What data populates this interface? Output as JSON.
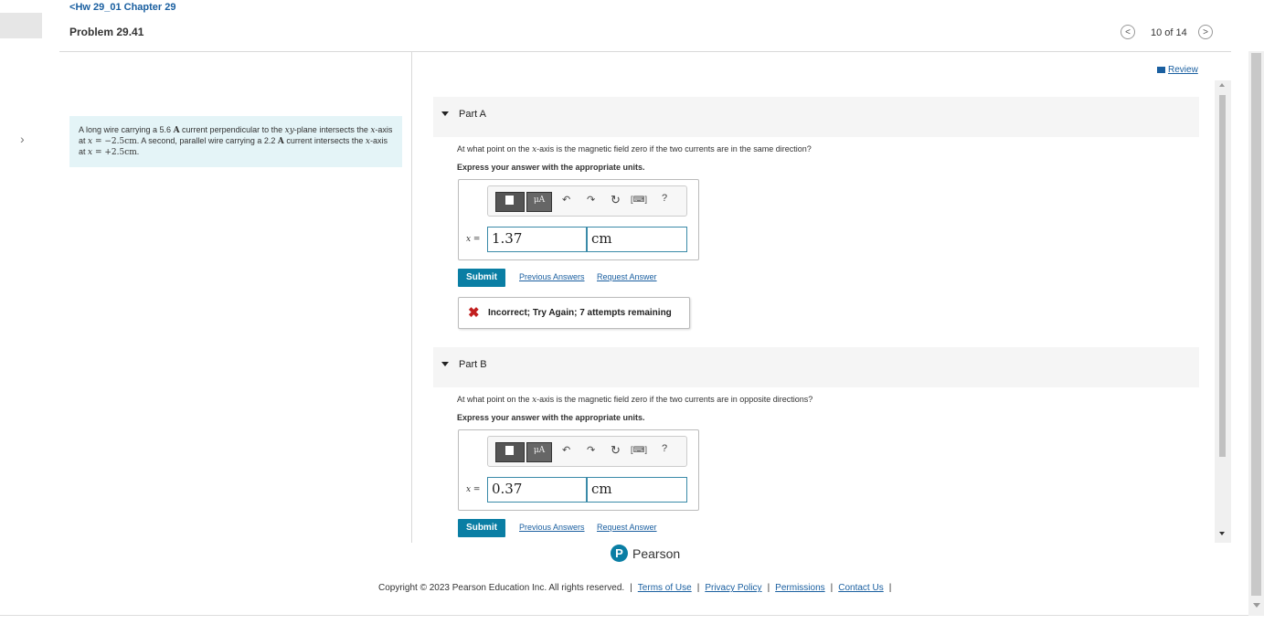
{
  "header": {
    "breadcrumb": "Hw 29_01 Chapter 29",
    "problem_title": "Problem 29.41",
    "counter": "10 of 14",
    "review_link": "Review"
  },
  "problem": {
    "t1": "A long wire carrying a 5.6 ",
    "t1_unit": "A",
    "t2": " current perpendicular to the ",
    "t2_math": "xy",
    "t3": "-plane intersects the ",
    "t3_math": "x",
    "t4": "-axis at ",
    "t4_math": "x",
    "t4_val": " = −2.5cm",
    "t5": ". A second, parallel wire carrying a 2.2 ",
    "t5_unit": "A",
    "t6": " current intersects the ",
    "t6_math": "x",
    "t7": "-axis at ",
    "t7_math": "x",
    "t7_val": " = +2.5cm",
    "t8": "."
  },
  "part_a": {
    "label": "Part A",
    "question_pre": "At what point on the ",
    "question_math": "x",
    "question_post": "-axis is the magnetic field zero if the two currents are in the same direction?",
    "express": "Express your answer with the appropriate units.",
    "var_label": "x =",
    "value": "1.37",
    "unit": "cm",
    "submit": "Submit",
    "previous_answers": "Previous Answers",
    "request_answer": "Request Answer",
    "feedback": "Incorrect; Try Again; 7 attempts remaining"
  },
  "part_b": {
    "label": "Part B",
    "question_pre": "At what point on the ",
    "question_math": "x",
    "question_post": "-axis is the magnetic field zero if the two currents are in opposite directions?",
    "express": "Express your answer with the appropriate units.",
    "var_label": "x =",
    "value": "0.37",
    "unit": "cm",
    "submit": "Submit",
    "previous_answers": "Previous Answers",
    "request_answer": "Request Answer"
  },
  "toolbar": {
    "mu_label": "μA",
    "help": "?"
  },
  "footer": {
    "brand": "Pearson",
    "brand_logo": "P",
    "copyright": "Copyright © 2023 Pearson Education Inc. All rights reserved.",
    "links": [
      "Terms of Use",
      "Privacy Policy",
      "Permissions",
      "Contact Us"
    ]
  },
  "icons": {
    "prev": "chevron-left-icon",
    "next": "chevron-right-icon",
    "undo": "undo-icon",
    "redo": "redo-icon",
    "reset": "reset-icon",
    "keyboard": "keyboard-icon",
    "incorrect": "x-mark-icon"
  },
  "colors": {
    "link": "#1a5fa0",
    "submit_bg": "#0a7ea4",
    "problem_bg": "#e4f4f7",
    "incorrect": "#c21f1f"
  }
}
